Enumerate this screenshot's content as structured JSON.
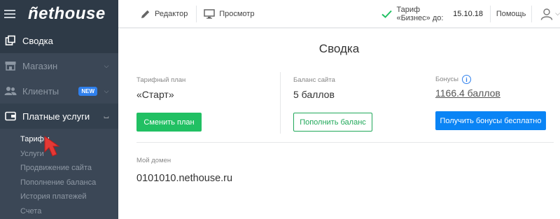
{
  "sidebar": {
    "logo": "ñethouse",
    "items": [
      {
        "label": "Сводка"
      },
      {
        "label": "Магазин"
      },
      {
        "label": "Клиенты",
        "badge": "NEW"
      },
      {
        "label": "Платные услуги"
      }
    ],
    "subitems": [
      {
        "label": "Тарифы"
      },
      {
        "label": "Услуги"
      },
      {
        "label": "Продвижение сайта"
      },
      {
        "label": "Пополнение баланса"
      },
      {
        "label": "История платежей"
      },
      {
        "label": "Счета"
      }
    ]
  },
  "topbar": {
    "editor_label": "Редактор",
    "preview_label": "Просмотр",
    "tariff_text": "Тариф «Бизнес» до:",
    "tariff_date": "15.10.18",
    "help_label": "Помощь"
  },
  "main": {
    "title": "Сводка",
    "plan": {
      "label": "Тарифный план",
      "value": "«Старт»",
      "button": "Сменить план"
    },
    "balance": {
      "label": "Баланс сайта",
      "value": "5 баллов",
      "button": "Пополнить баланс"
    },
    "bonus": {
      "label": "Бонусы",
      "value": "1166.4 баллов",
      "button": "Получить бонусы бесплатно",
      "info_symbol": "i"
    },
    "domain": {
      "label": "Мой домен",
      "value": "0101010.nethouse.ru"
    }
  },
  "colors": {
    "sidebar_bg": "#3b4756",
    "sidebar_header_bg": "#2e3a47",
    "green": "#21c063",
    "blue": "#0a84f5",
    "badge": "#2f80ed",
    "pointer": "#e53935"
  }
}
